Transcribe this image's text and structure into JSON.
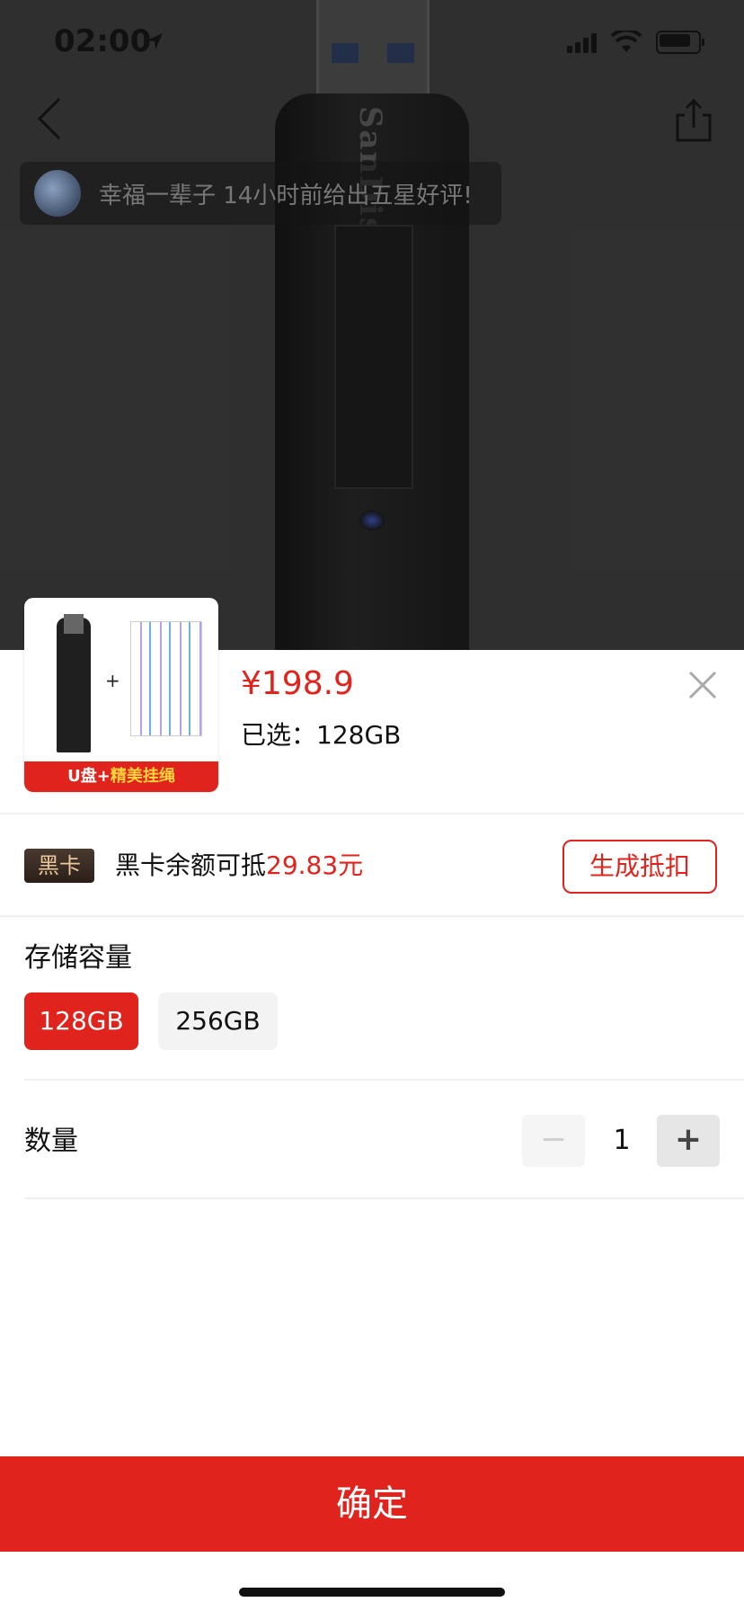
{
  "status_bar": {
    "time": "02:00"
  },
  "notification": {
    "user": "幸福一辈子",
    "text": "幸福一辈子 14小时前给出五星好评!"
  },
  "product_image": {
    "brand": "SanDisk"
  },
  "sheet": {
    "thumbnail_caption_prefix": "U盘+",
    "thumbnail_caption_highlight": "精美挂绳",
    "price": "¥198.9",
    "selected_label": "已选：128GB"
  },
  "vip": {
    "badge": "黑卡",
    "text": "黑卡余额可抵",
    "amount": "29.83元",
    "button": "生成抵扣"
  },
  "storage": {
    "title": "存储容量",
    "options": [
      {
        "label": "128GB",
        "selected": true
      },
      {
        "label": "256GB",
        "selected": false
      }
    ]
  },
  "quantity": {
    "title": "数量",
    "value": "1",
    "minus": "−",
    "plus": "+"
  },
  "confirm_button": "确定",
  "colors": {
    "accent": "#e0231c",
    "vip_gold": "#e9c79a"
  }
}
